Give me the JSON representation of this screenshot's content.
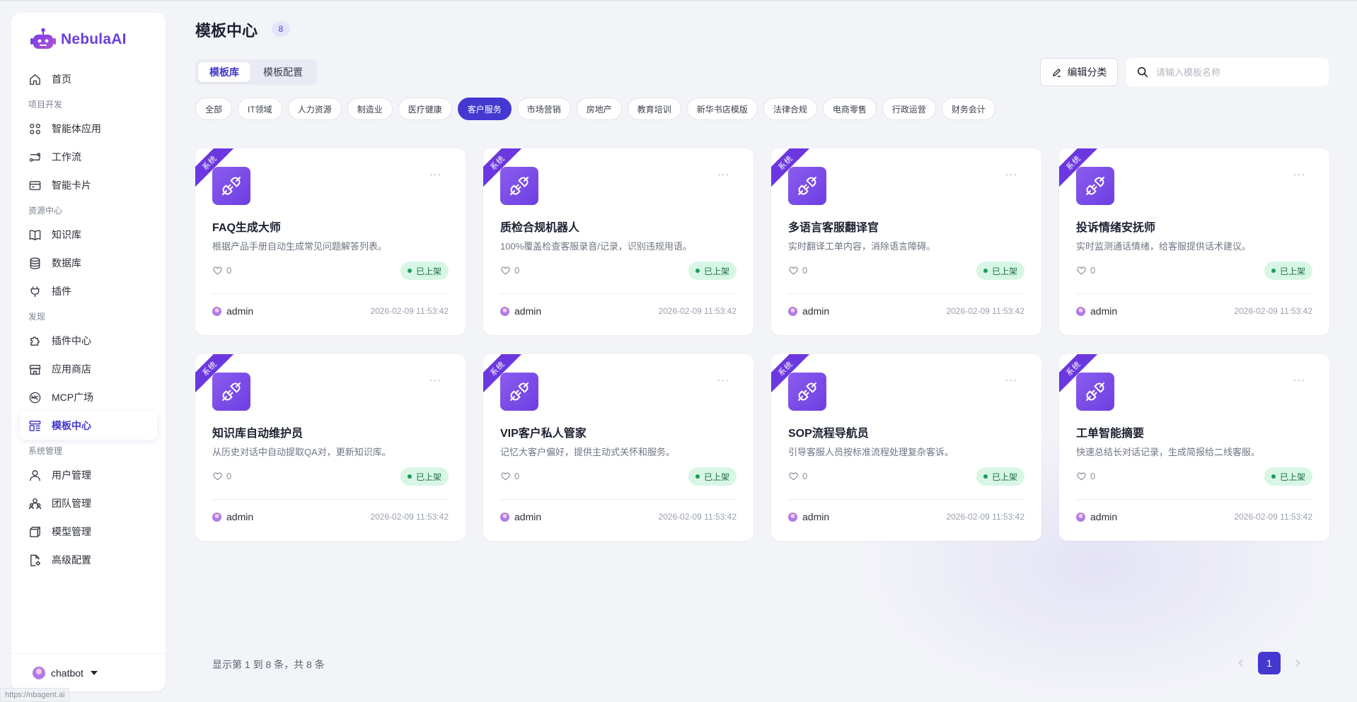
{
  "app": {
    "logo_text": "NebulaAI",
    "url_hint": "https://nbagent.ai"
  },
  "sidebar": {
    "groups": [
      {
        "label": "",
        "items": [
          {
            "label": "首页",
            "icon": "home-icon",
            "active": false
          }
        ]
      },
      {
        "label": "项目开发",
        "items": [
          {
            "label": "智能体应用",
            "icon": "grid-apps-icon",
            "active": false
          },
          {
            "label": "工作流",
            "icon": "workflow-icon",
            "active": false
          },
          {
            "label": "智能卡片",
            "icon": "card-icon",
            "active": false
          }
        ]
      },
      {
        "label": "资源中心",
        "items": [
          {
            "label": "知识库",
            "icon": "book-icon",
            "active": false
          },
          {
            "label": "数据库",
            "icon": "database-icon",
            "active": false
          },
          {
            "label": "插件",
            "icon": "plug-icon",
            "active": false
          }
        ]
      },
      {
        "label": "发现",
        "items": [
          {
            "label": "插件中心",
            "icon": "puzzle-icon",
            "active": false
          },
          {
            "label": "应用商店",
            "icon": "store-icon",
            "active": false
          },
          {
            "label": "MCP广场",
            "icon": "mcp-icon",
            "active": false
          },
          {
            "label": "模板中心",
            "icon": "template-icon",
            "active": true
          }
        ]
      },
      {
        "label": "系统管理",
        "items": [
          {
            "label": "用户管理",
            "icon": "user-icon",
            "active": false
          },
          {
            "label": "团队管理",
            "icon": "team-icon",
            "active": false
          },
          {
            "label": "模型管理",
            "icon": "cube-icon",
            "active": false
          },
          {
            "label": "高级配置",
            "icon": "settings-file-icon",
            "active": false
          }
        ]
      }
    ],
    "user": {
      "name": "chatbot"
    }
  },
  "header": {
    "title": "模板中心",
    "count": "8"
  },
  "tabs": [
    {
      "label": "模板库",
      "active": true
    },
    {
      "label": "模板配置",
      "active": false
    }
  ],
  "toolbar": {
    "edit_label": "编辑分类",
    "search_placeholder": "请输入模板名称",
    "search_value": ""
  },
  "categories": [
    {
      "label": "全部",
      "active": false
    },
    {
      "label": "IT领域",
      "active": false
    },
    {
      "label": "人力资源",
      "active": false
    },
    {
      "label": "制造业",
      "active": false
    },
    {
      "label": "医疗健康",
      "active": false
    },
    {
      "label": "客户服务",
      "active": true
    },
    {
      "label": "市场营销",
      "active": false
    },
    {
      "label": "房地产",
      "active": false
    },
    {
      "label": "教育培训",
      "active": false
    },
    {
      "label": "新华书店模版",
      "active": false
    },
    {
      "label": "法律合规",
      "active": false
    },
    {
      "label": "电商零售",
      "active": false
    },
    {
      "label": "行政运营",
      "active": false
    },
    {
      "label": "财务会计",
      "active": false
    }
  ],
  "cards": [
    {
      "ribbon": "系统",
      "title": "FAQ生成大师",
      "desc": "根据产品手册自动生成常见问题解答列表。",
      "likes": "0",
      "status": "已上架",
      "author": "admin",
      "date": "2026-02-09 11:53:42"
    },
    {
      "ribbon": "系统",
      "title": "质检合规机器人",
      "desc": "100%覆盖检查客服录音/记录，识别违规用语。",
      "likes": "0",
      "status": "已上架",
      "author": "admin",
      "date": "2026-02-09 11:53:42"
    },
    {
      "ribbon": "系统",
      "title": "多语言客服翻译官",
      "desc": "实时翻译工单内容，消除语言障碍。",
      "likes": "0",
      "status": "已上架",
      "author": "admin",
      "date": "2026-02-09 11:53:42"
    },
    {
      "ribbon": "系统",
      "title": "投诉情绪安抚师",
      "desc": "实时监测通话情绪，给客服提供话术建议。",
      "likes": "0",
      "status": "已上架",
      "author": "admin",
      "date": "2026-02-09 11:53:42"
    },
    {
      "ribbon": "系统",
      "title": "知识库自动维护员",
      "desc": "从历史对话中自动提取QA对，更新知识库。",
      "likes": "0",
      "status": "已上架",
      "author": "admin",
      "date": "2026-02-09 11:53:42"
    },
    {
      "ribbon": "系统",
      "title": "VIP客户私人管家",
      "desc": "记忆大客户偏好，提供主动式关怀和服务。",
      "likes": "0",
      "status": "已上架",
      "author": "admin",
      "date": "2026-02-09 11:53:42"
    },
    {
      "ribbon": "系统",
      "title": "SOP流程导航员",
      "desc": "引导客服人员按标准流程处理复杂客诉。",
      "likes": "0",
      "status": "已上架",
      "author": "admin",
      "date": "2026-02-09 11:53:42"
    },
    {
      "ribbon": "系统",
      "title": "工单智能摘要",
      "desc": "快速总结长对话记录，生成简报给二线客服。",
      "likes": "0",
      "status": "已上架",
      "author": "admin",
      "date": "2026-02-09 11:53:42"
    }
  ],
  "pagination": {
    "summary": "显示第 1 到 8 条，共 8 条",
    "current": "1"
  },
  "colors": {
    "accent": "#4438d0",
    "brand": "#6b3fe0",
    "status_green_bg": "#d8f6e6",
    "status_green_text": "#17713f"
  }
}
